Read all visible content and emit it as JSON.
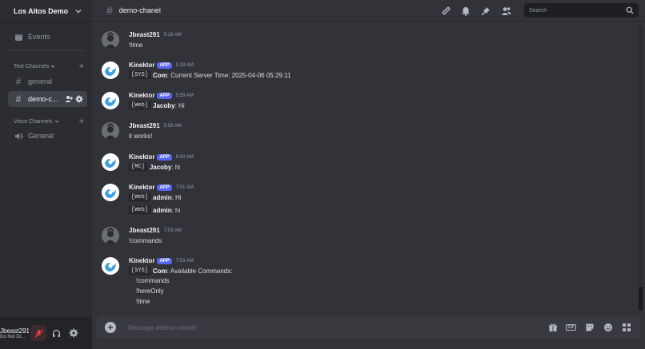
{
  "server": {
    "name": "Los Altos Demo"
  },
  "sidebar": {
    "events_label": "Events",
    "text_category": "Text Channels",
    "voice_category": "Voice Channels",
    "text_channels": [
      {
        "name": "general"
      },
      {
        "name": "demo-c..."
      }
    ],
    "voice_channels": [
      {
        "name": "General"
      }
    ]
  },
  "header": {
    "channel_name": "demo-chanel",
    "search_placeholder": "Search"
  },
  "messages": [
    {
      "author": "Jbeast291",
      "time": "5:29 AM",
      "text": "!time"
    },
    {
      "author": "Kinektor",
      "badge": "APP",
      "time": "5:29 AM",
      "tag": "[SYS]",
      "sender": "Com",
      "text": ": Current Server Time: 2025-04-06 05:29:11"
    },
    {
      "author": "Kinektor",
      "badge": "APP",
      "time": "5:59 AM",
      "tag": "[Web]",
      "sender": "Jacoby",
      "text": ": Hi"
    },
    {
      "author": "Jbeast291",
      "time": "5:59 AM",
      "text": "it works!"
    },
    {
      "author": "Kinektor",
      "badge": "APP",
      "time": "6:00 AM",
      "tag": "[MC]",
      "sender": "Jacoby",
      "text": ": hi"
    },
    {
      "author": "Kinektor",
      "badge": "APP",
      "time": "7:01 AM",
      "tag": "[Web]",
      "sender": "admin",
      "text": ": Hi",
      "tag2": "[Web]",
      "sender2": "admin",
      "text2": ": hi"
    },
    {
      "author": "Jbeast291",
      "time": "7:03 AM",
      "text": "!commands"
    },
    {
      "author": "Kinektor",
      "badge": "APP",
      "time": "7:03 AM",
      "tag": "[SYS]",
      "sender": "Com",
      "text": ": Available Commands:",
      "list": [
        "!commands",
        "!hereOnly",
        "!time"
      ]
    }
  ],
  "composer": {
    "placeholder": "Message #demo-chanel"
  },
  "user": {
    "name": "Jbeast291",
    "status": "Do Not Di..."
  },
  "colors": {
    "accent": "#5865f2",
    "muted_red": "#f23f43",
    "background": "#313338",
    "sidebar": "#2b2d31"
  }
}
